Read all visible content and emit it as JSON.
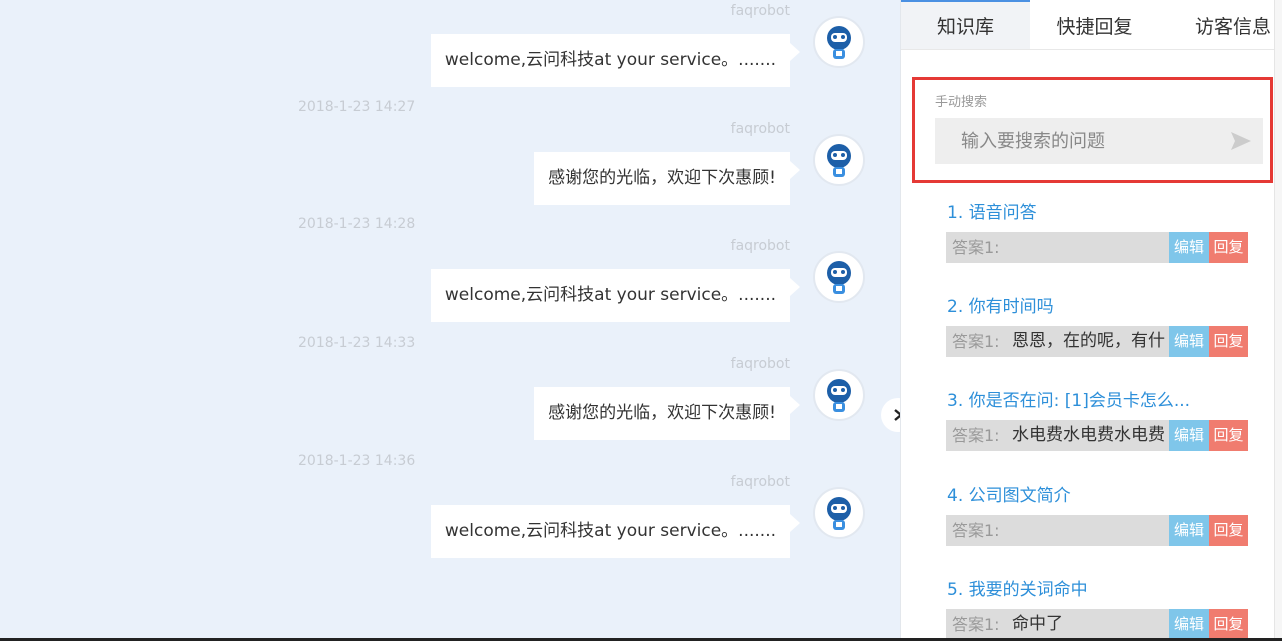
{
  "chat": {
    "sender_name": "faqrobot",
    "messages": [
      {
        "text": "welcome,云问科技at your service。......."
      },
      {
        "text": "感谢您的光临，欢迎下次惠顾!"
      },
      {
        "text": "welcome,云问科技at your service。......."
      },
      {
        "text": "感谢您的光临，欢迎下次惠顾!"
      },
      {
        "text": "welcome,云问科技at your service。......."
      }
    ],
    "timestamps": [
      "2018-1-23 14:27",
      "2018-1-23 14:28",
      "2018-1-23 14:33",
      "2018-1-23 14:36"
    ]
  },
  "panel": {
    "tabs": [
      {
        "label": "知识库"
      },
      {
        "label": "快捷回复"
      },
      {
        "label": "访客信息"
      }
    ],
    "search": {
      "label": "手动搜索",
      "placeholder": "输入要搜索的问题"
    },
    "items": [
      {
        "title": "1. 语音问答",
        "answer_label": "答案1:",
        "answer_text": "",
        "edit_label": "编辑",
        "reply_label": "回复"
      },
      {
        "title": "2. 你有时间吗",
        "answer_label": "答案1:",
        "answer_text": "恩恩，在的呢，有什",
        "edit_label": "编辑",
        "reply_label": "回复"
      },
      {
        "title": "3. 你是否在问: [1]会员卡怎么...",
        "answer_label": "答案1:",
        "answer_text": "水电费水电费水电费",
        "edit_label": "编辑",
        "reply_label": "回复"
      },
      {
        "title": "4. 公司图文简介",
        "answer_label": "答案1:",
        "answer_text": "",
        "edit_label": "编辑",
        "reply_label": "回复"
      },
      {
        "title": "5. 我要的关词命中",
        "answer_label": "答案1:",
        "answer_text": "命中了",
        "edit_label": "编辑",
        "reply_label": "回复"
      }
    ]
  },
  "colors": {
    "link_blue": "#2d8fd9",
    "edit_button": "#7fc6ea",
    "reply_button": "#f07c6f",
    "highlight_border": "#e53935"
  },
  "icons": {
    "avatar": "robot-avatar-icon",
    "send": "send-icon",
    "collapse": "chevron-right-icon"
  }
}
